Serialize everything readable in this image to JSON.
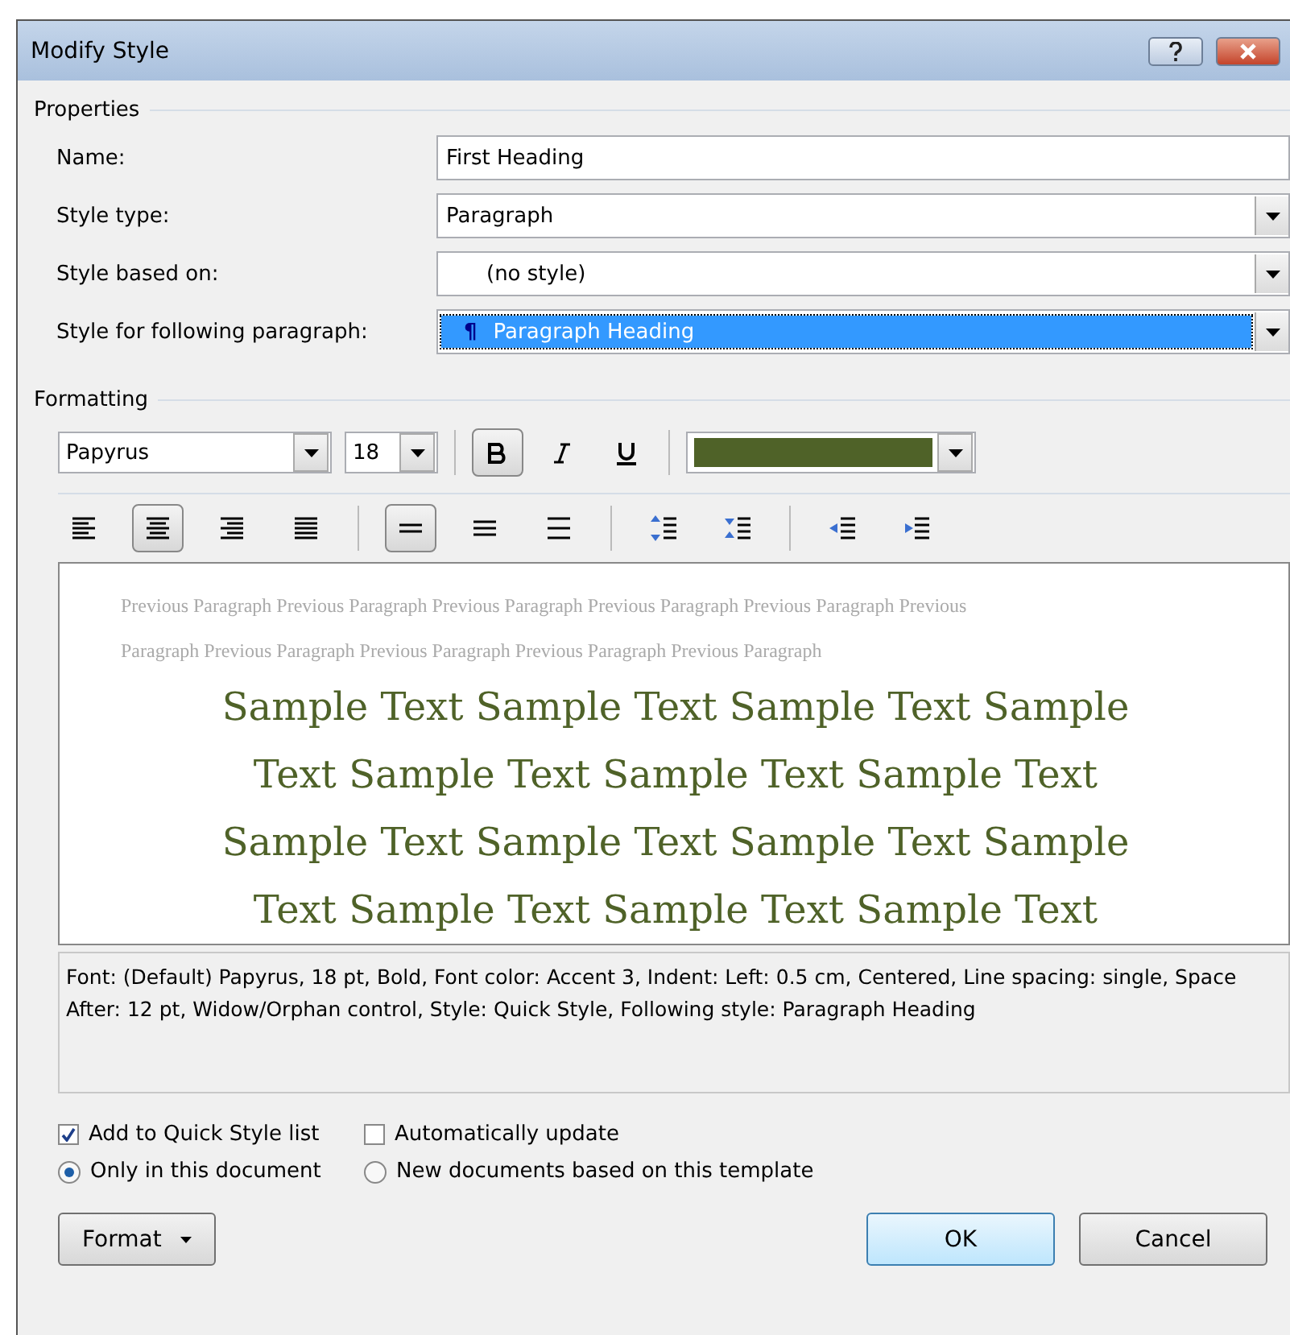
{
  "window": {
    "title": "Modify Style"
  },
  "properties": {
    "title": "Properties",
    "fields": [
      {
        "label": "Name:",
        "value": "First Heading",
        "kind": "text",
        "selected": false
      },
      {
        "label": "Style type:",
        "value": "Paragraph",
        "kind": "dropdown",
        "selected": false
      },
      {
        "label": "Style based on:",
        "value": "(no style)",
        "kind": "dropdown",
        "selected": false
      },
      {
        "label": "Style for following paragraph:",
        "value": "Paragraph Heading",
        "mark": "¶",
        "kind": "dropdown",
        "selected": true
      }
    ]
  },
  "formatting": {
    "title": "Formatting",
    "font": "Papyrus",
    "size": "18",
    "styles": [
      {
        "kind": "bold",
        "selected": true
      },
      {
        "kind": "italic",
        "selected": false
      },
      {
        "kind": "underline",
        "selected": false
      }
    ],
    "color_swatch": {
      "color": "#4f6228"
    },
    "paragraph_tools": [
      {
        "kind": "align-left",
        "selected": false
      },
      {
        "kind": "align-center",
        "selected": true
      },
      {
        "kind": "align-right",
        "selected": false
      },
      {
        "kind": "justify",
        "selected": false
      },
      {
        "kind": "sep"
      },
      {
        "kind": "single-spacing",
        "selected": true
      },
      {
        "kind": "one-half-spacing",
        "selected": false
      },
      {
        "kind": "double-spacing",
        "selected": false
      },
      {
        "kind": "sep"
      },
      {
        "kind": "increase-spacing",
        "selected": false
      },
      {
        "kind": "decrease-spacing",
        "selected": false
      },
      {
        "kind": "sep"
      },
      {
        "kind": "decrease-indent",
        "selected": false
      },
      {
        "kind": "increase-indent",
        "selected": false
      }
    ],
    "preview": {
      "previous_lines": [
        "Previous Paragraph Previous Paragraph Previous Paragraph Previous Paragraph Previous Paragraph Previous",
        "Paragraph Previous Paragraph Previous Paragraph Previous Paragraph Previous Paragraph"
      ],
      "sample_lines": [
        "Sample Text Sample Text Sample Text Sample",
        "Text Sample Text Sample Text Sample Text",
        "Sample Text Sample Text Sample Text Sample",
        "Text Sample Text Sample Text Sample Text"
      ]
    },
    "description": "Font: (Default) Papyrus, 18 pt, Bold, Font color: Accent 3, Indent: Left:  0.5 cm, Centered, Line spacing:  single, Space After:  12 pt, Widow/Orphan control, Style: Quick Style, Following style: Paragraph Heading"
  },
  "checkboxes": [
    {
      "label": "Add to Quick Style list",
      "checked": true
    },
    {
      "label": "Automatically update",
      "checked": false
    }
  ],
  "radios": [
    {
      "label": "Only in this document",
      "selected": true
    },
    {
      "label": "New documents based on this template",
      "selected": false
    }
  ],
  "buttons": {
    "format": "Format",
    "ok": "OK",
    "cancel": "Cancel"
  }
}
